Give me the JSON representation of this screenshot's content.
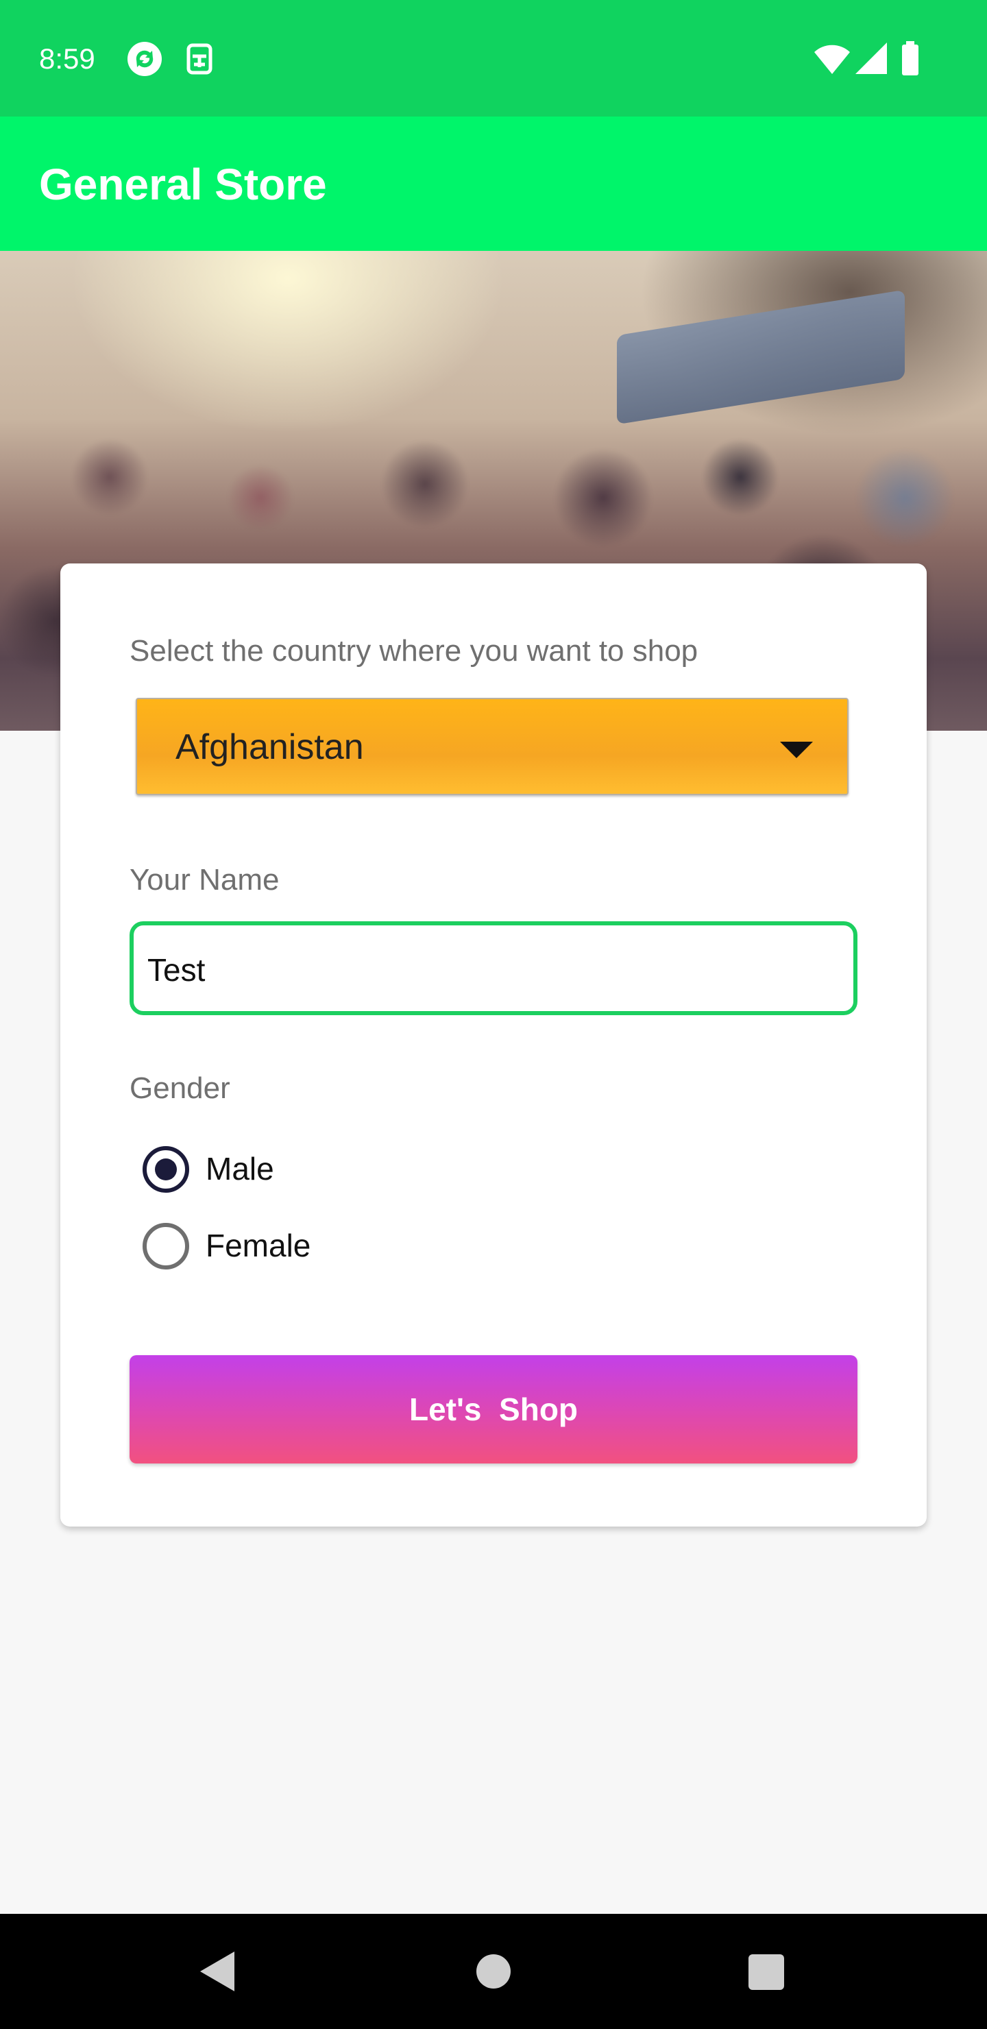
{
  "status_bar": {
    "time": "8:59",
    "icons": [
      "sync-icon",
      "clipboard-icon",
      "wifi-icon",
      "cellular-signal-icon",
      "battery-icon"
    ]
  },
  "app_bar": {
    "title": "General Store"
  },
  "form": {
    "country_label": "Select the country where you want to shop",
    "country_value": "Afghanistan",
    "name_label": "Your Name",
    "name_value": "Test",
    "gender_label": "Gender",
    "gender_options": [
      {
        "label": "Male",
        "checked": true
      },
      {
        "label": "Female",
        "checked": false
      }
    ],
    "submit_label": "Let's  Shop"
  },
  "nav_bar": {
    "icons": [
      "back-icon",
      "home-icon",
      "recents-icon"
    ]
  },
  "colors": {
    "status_bar": "#10d35f",
    "app_bar": "#00f56a",
    "dropdown": "#f6a623",
    "field_border": "#1ccf5f",
    "button_top": "#c340e8",
    "button_bottom": "#f2517f"
  }
}
